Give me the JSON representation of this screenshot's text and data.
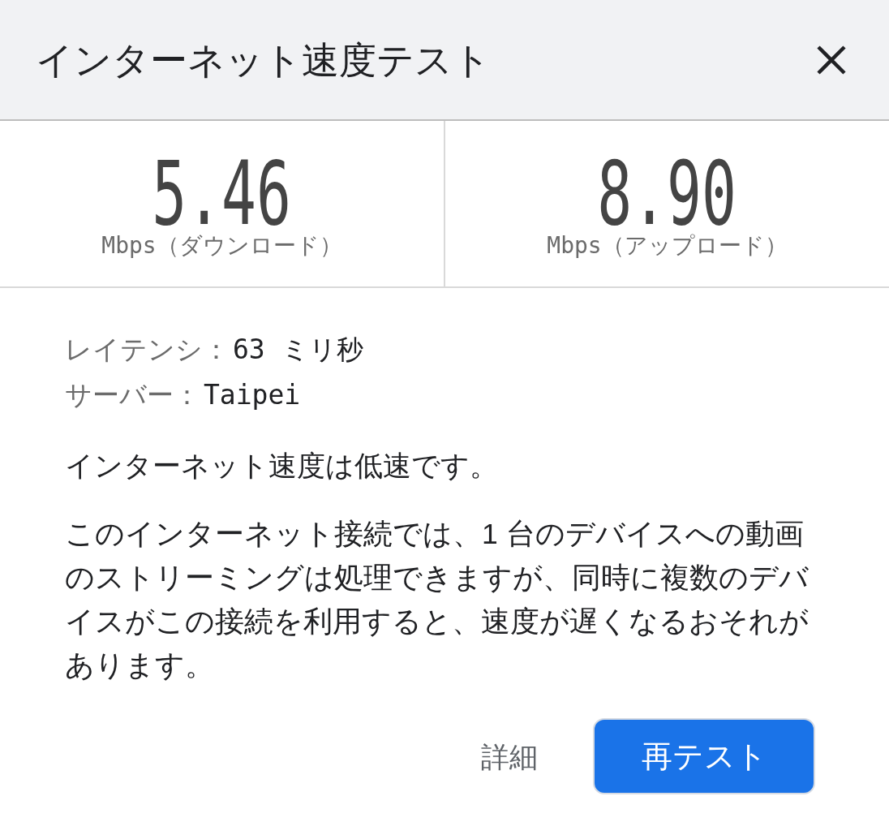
{
  "dialog": {
    "title": "インターネット速度テスト"
  },
  "results": [
    {
      "value": "5.46",
      "unit": "Mbps（ダウンロード）"
    },
    {
      "value": "8.90",
      "unit": "Mbps（アップロード）"
    }
  ],
  "details": [
    {
      "label": "レイテンシ：",
      "value": "63 ミリ秒"
    },
    {
      "label": "サーバー：",
      "value": "Taipei"
    }
  ],
  "summary": "インターネット速度は低速です。",
  "description": "このインターネット接続では、1 台のデバイスへの動画のストリーミングは処理できますが、同時に複数のデバイスがこの接続を利用すると、速度が遅くなるおそれがあります。",
  "buttons": [
    {
      "label": "詳細",
      "kind": "text"
    },
    {
      "label": "再テスト",
      "kind": "primary"
    }
  ]
}
